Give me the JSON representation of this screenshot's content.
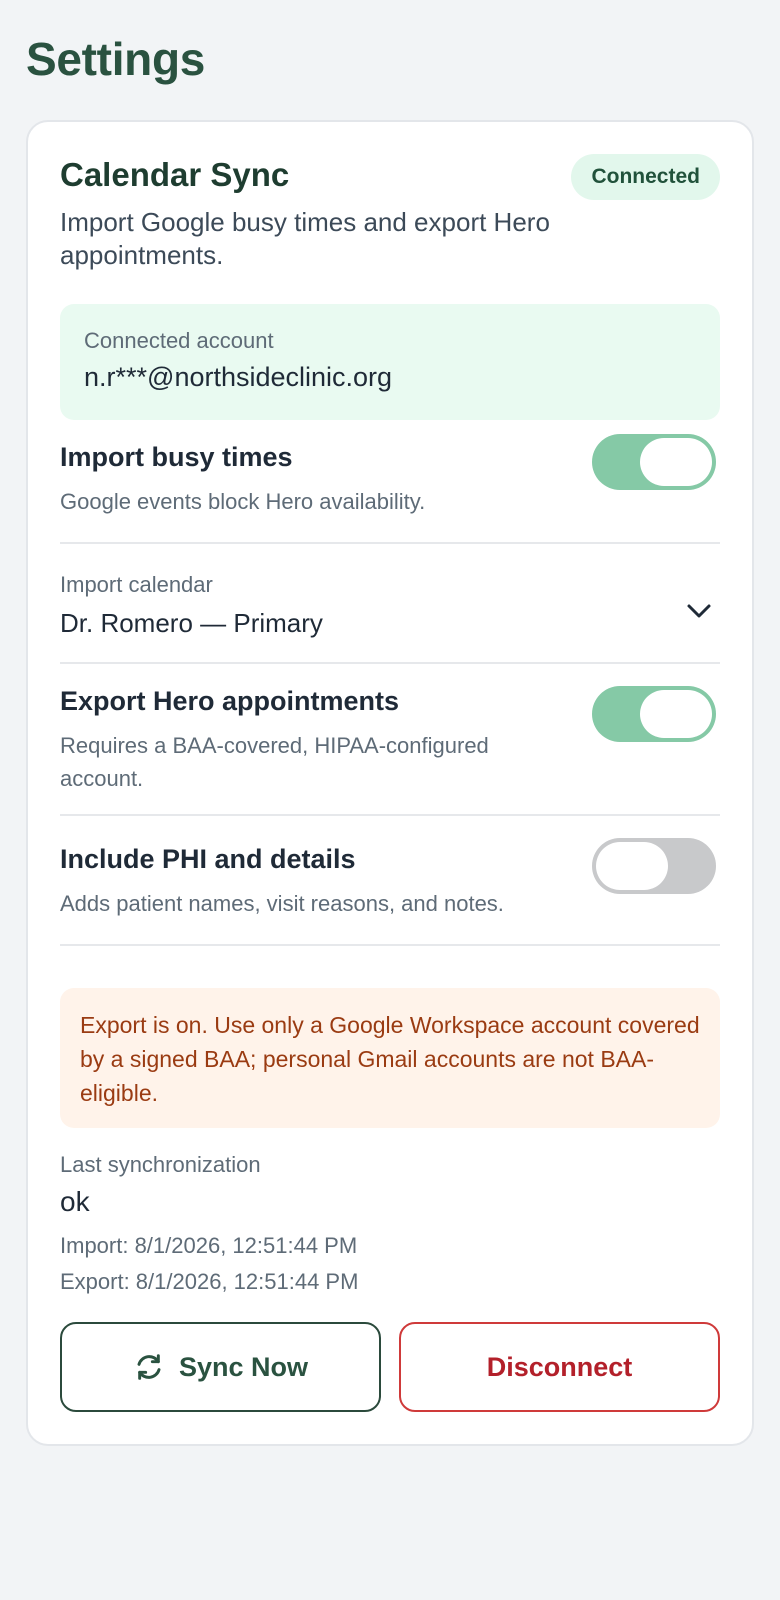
{
  "page": {
    "title": "Settings"
  },
  "calendar_sync": {
    "title": "Calendar Sync",
    "status_badge": "Connected",
    "description": "Import Google busy times and export Hero appointments.",
    "account": {
      "label": "Connected account",
      "email": "n.r***@northsideclinic.org"
    },
    "import_busy": {
      "title": "Import busy times",
      "subtitle": "Google events block Hero availability.",
      "enabled": true
    },
    "import_calendar": {
      "label": "Import calendar",
      "value": "Dr. Romero — Primary"
    },
    "export_appointments": {
      "title": "Export Hero appointments",
      "subtitle": "Requires a BAA-covered, HIPAA-configured account.",
      "enabled": true
    },
    "include_phi": {
      "title": "Include PHI and details",
      "subtitle": "Adds patient names, visit reasons, and notes.",
      "enabled": false
    },
    "warning": "Export is on. Use only a Google Workspace account covered by a signed BAA; personal Gmail accounts are not BAA-eligible.",
    "last_sync": {
      "label": "Last synchronization",
      "status": "ok",
      "import_line": "Import: 8/1/2026, 12:51:44 PM",
      "export_line": "Export: 8/1/2026, 12:51:44 PM"
    },
    "buttons": {
      "sync_now": "Sync Now",
      "disconnect": "Disconnect"
    }
  },
  "colors": {
    "title": "#2a5240",
    "toggle_on": "#85c9a6",
    "toggle_off": "#c8c9cb",
    "badge_bg": "#e2f7ec",
    "warning_bg": "#fff3ea",
    "warning_text": "#9a3b12",
    "danger": "#cf3a3a"
  },
  "icons": {
    "sync": "refresh-icon",
    "dropdown": "chevron-down-icon"
  }
}
